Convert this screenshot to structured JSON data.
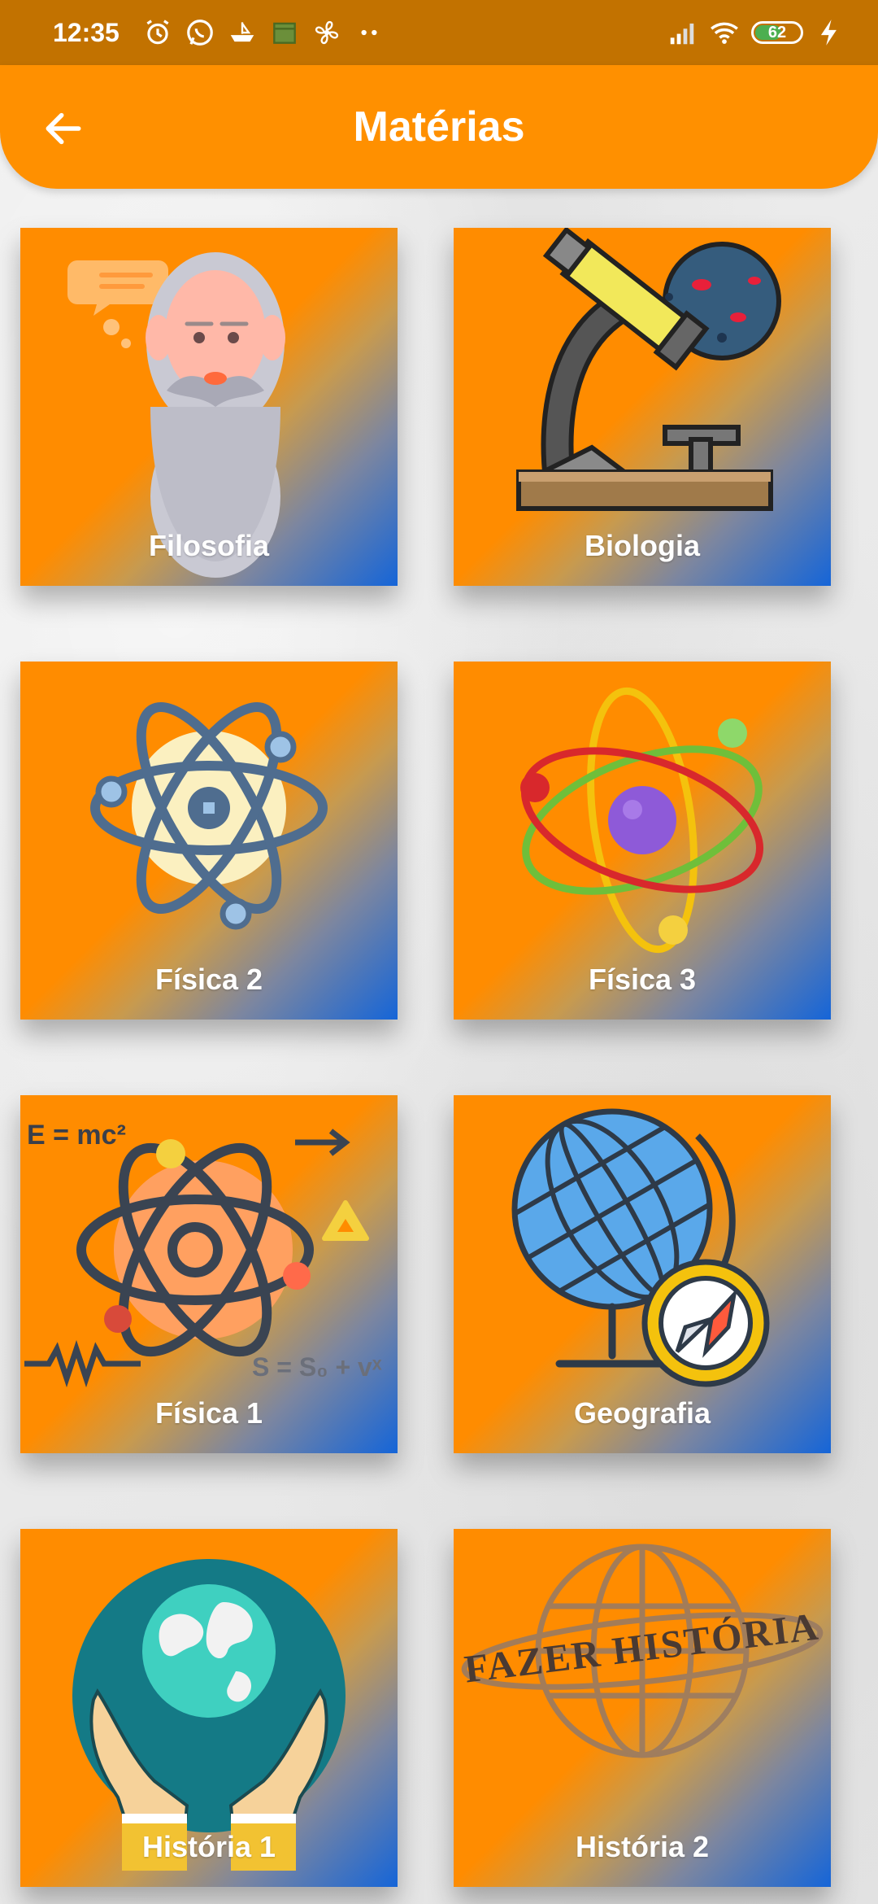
{
  "status_bar": {
    "time": "12:35",
    "battery": "62",
    "battery_level": 0.62,
    "left_icons": [
      "alarm-icon",
      "whatsapp-icon",
      "boat-icon",
      "calendar-icon",
      "fan-icon",
      "more-dots-icon"
    ],
    "right_icons": [
      "signal-icon",
      "wifi-icon",
      "battery-icon",
      "charging-icon"
    ]
  },
  "app_bar": {
    "title": "Matérias",
    "back_icon": "arrow-back-icon",
    "color": "#ff9000"
  },
  "subjects": [
    {
      "label": "Filosofia",
      "icon": "philosopher-icon"
    },
    {
      "label": "Biologia",
      "icon": "microscope-icon"
    },
    {
      "label": "Física 2",
      "icon": "atom-icon"
    },
    {
      "label": "Física 3",
      "icon": "orbit-icon"
    },
    {
      "label": "Física 1",
      "icon": "physics-formula-icon"
    },
    {
      "label": "Geografia",
      "icon": "globe-compass-icon"
    },
    {
      "label": "História 1",
      "icon": "hands-earth-icon"
    },
    {
      "label": "História 2",
      "icon": "fazer-historia-icon"
    }
  ],
  "card_art_text": {
    "emc2": "E = mc²",
    "formula": "S = S₀ + vˣ",
    "fazer": "FAZER HISTÓRIA"
  },
  "colors": {
    "accent": "#ff9000",
    "status_bar": "#c27200",
    "card_gradient_start": "#ff8c00",
    "card_gradient_end": "#1565d8"
  }
}
